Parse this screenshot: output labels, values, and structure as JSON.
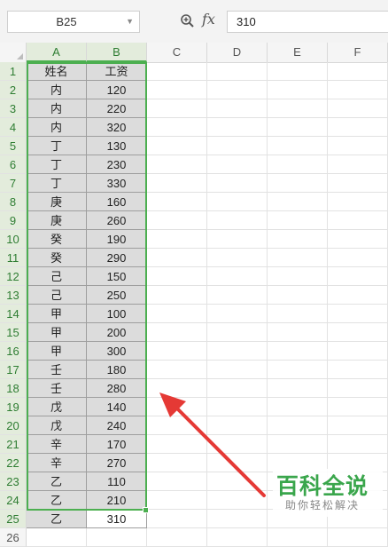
{
  "formula_bar": {
    "name_box": "B25",
    "fx_label": "fx",
    "formula_value": "310"
  },
  "columns": [
    "A",
    "B",
    "C",
    "D",
    "E",
    "F"
  ],
  "rows": [
    {
      "num": "1",
      "a": "姓名",
      "b": "工资"
    },
    {
      "num": "2",
      "a": "内",
      "b": "120"
    },
    {
      "num": "3",
      "a": "内",
      "b": "220"
    },
    {
      "num": "4",
      "a": "内",
      "b": "320"
    },
    {
      "num": "5",
      "a": "丁",
      "b": "130"
    },
    {
      "num": "6",
      "a": "丁",
      "b": "230"
    },
    {
      "num": "7",
      "a": "丁",
      "b": "330"
    },
    {
      "num": "8",
      "a": "庚",
      "b": "160"
    },
    {
      "num": "9",
      "a": "庚",
      "b": "260"
    },
    {
      "num": "10",
      "a": "癸",
      "b": "190"
    },
    {
      "num": "11",
      "a": "癸",
      "b": "290"
    },
    {
      "num": "12",
      "a": "己",
      "b": "150"
    },
    {
      "num": "13",
      "a": "己",
      "b": "250"
    },
    {
      "num": "14",
      "a": "甲",
      "b": "100"
    },
    {
      "num": "15",
      "a": "甲",
      "b": "200"
    },
    {
      "num": "16",
      "a": "甲",
      "b": "300"
    },
    {
      "num": "17",
      "a": "壬",
      "b": "180"
    },
    {
      "num": "18",
      "a": "壬",
      "b": "280"
    },
    {
      "num": "19",
      "a": "戊",
      "b": "140"
    },
    {
      "num": "20",
      "a": "戊",
      "b": "240"
    },
    {
      "num": "21",
      "a": "辛",
      "b": "170"
    },
    {
      "num": "22",
      "a": "辛",
      "b": "270"
    },
    {
      "num": "23",
      "a": "乙",
      "b": "110"
    },
    {
      "num": "24",
      "a": "乙",
      "b": "210"
    },
    {
      "num": "25",
      "a": "乙",
      "b": "310"
    },
    {
      "num": "26",
      "a": "",
      "b": ""
    }
  ],
  "watermark": {
    "main": "百科全说",
    "sub": "助你轻松解决"
  },
  "colors": {
    "selection": "#4caf50",
    "arrow": "#e53935",
    "watermark": "#3aa64c"
  }
}
